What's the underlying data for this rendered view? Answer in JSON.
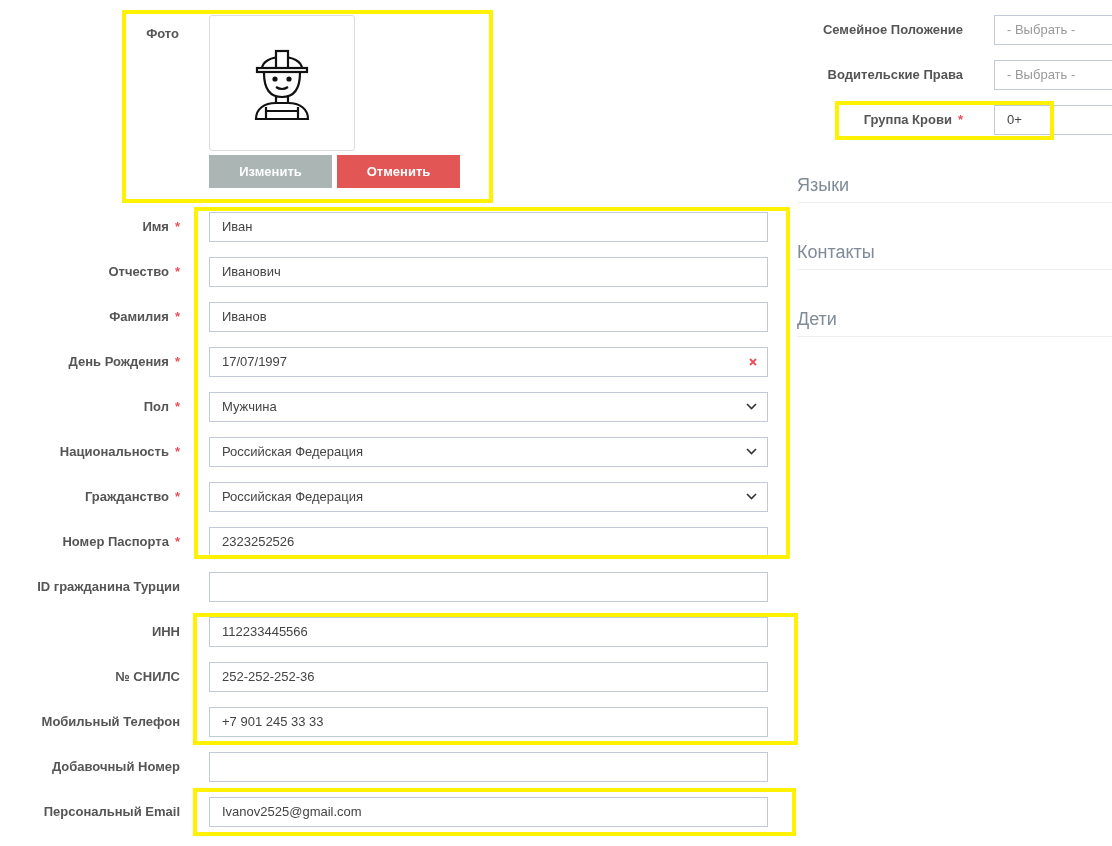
{
  "photo": {
    "label": "Фото",
    "buttons": [
      {
        "label": "Изменить",
        "kind": "change"
      },
      {
        "label": "Отменить",
        "kind": "cancel"
      }
    ]
  },
  "left_fields": [
    {
      "label": "Имя",
      "required_mark": "*",
      "kind": "text",
      "value": "Иван"
    },
    {
      "label": "Отчество",
      "required_mark": "*",
      "kind": "text",
      "value": "Иванович"
    },
    {
      "label": "Фамилия",
      "required_mark": "*",
      "kind": "text",
      "value": "Иванов"
    },
    {
      "label": "День Рождения",
      "required_mark": "*",
      "kind": "date",
      "value": "17/07/1997"
    },
    {
      "label": "Пол",
      "required_mark": "*",
      "kind": "select",
      "value": "Мужчина"
    },
    {
      "label": "Национальность",
      "required_mark": "*",
      "kind": "select",
      "value": "Российская Федерация"
    },
    {
      "label": "Гражданство",
      "required_mark": "*",
      "kind": "select",
      "value": "Российская Федерация"
    },
    {
      "label": "Номер Паспорта",
      "required_mark": "*",
      "kind": "text",
      "value": "2323252526"
    },
    {
      "label": "ID гражданина Турции",
      "kind": "text"
    },
    {
      "label": "ИНН",
      "kind": "text",
      "value": "112233445566"
    },
    {
      "label": "№ СНИЛС",
      "kind": "text",
      "value": "252-252-252-36"
    },
    {
      "label": "Мобильный Телефон",
      "kind": "text",
      "value": "+7 901 245 33 33"
    },
    {
      "label": "Добавочный Номер",
      "kind": "text"
    },
    {
      "label": "Персональный Email",
      "kind": "text",
      "value": "Ivanov2525@gmail.com"
    }
  ],
  "right_fields": [
    {
      "label": "Семейное Положение",
      "placeholder": "- Выбрать -"
    },
    {
      "label": "Водительские Права",
      "placeholder": "- Выбрать -"
    },
    {
      "label": "Группа Крови",
      "required_mark": "*",
      "value": "0+"
    }
  ],
  "sections": [
    "Языки",
    "Контакты",
    "Дети"
  ]
}
